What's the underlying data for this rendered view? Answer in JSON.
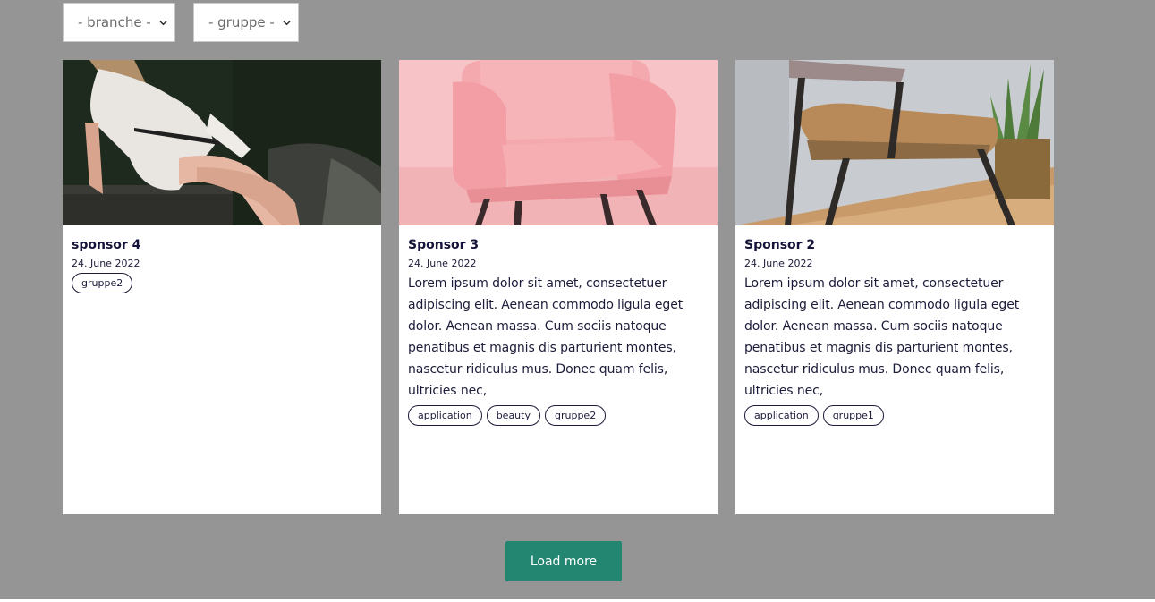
{
  "filters": {
    "branche": "- branche -",
    "gruppe": "- gruppe -"
  },
  "cards": [
    {
      "title": "sponsor 4",
      "date": "24. June 2022",
      "text": "",
      "image": "woman-in-white-dress-photo",
      "tags": [
        "gruppe2"
      ]
    },
    {
      "title": "Sponsor 3",
      "date": "24. June 2022",
      "text": "Lorem ipsum dolor sit amet, consectetuer adipiscing elit. Aenean commodo ligula eget dolor. Aenean massa. Cum sociis natoque penatibus et magnis dis parturient montes, nascetur ridiculus mus. Donec quam felis, ultricies nec,",
      "image": "pink-armchair-photo",
      "tags": [
        "application",
        "beauty",
        "gruppe2"
      ]
    },
    {
      "title": "Sponsor 2",
      "date": "24. June 2022",
      "text": "Lorem ipsum dolor sit amet, consectetuer adipiscing elit. Aenean commodo ligula eget dolor. Aenean massa. Cum sociis natoque penatibus et magnis dis parturient montes, nascetur ridiculus mus. Donec quam felis, ultricies nec,",
      "image": "brown-lounge-chair-photo",
      "tags": [
        "application",
        "gruppe1"
      ]
    }
  ],
  "load_more": "Load more",
  "colors": {
    "background": "#959595",
    "button": "#238671",
    "text": "#1b1b3a"
  }
}
